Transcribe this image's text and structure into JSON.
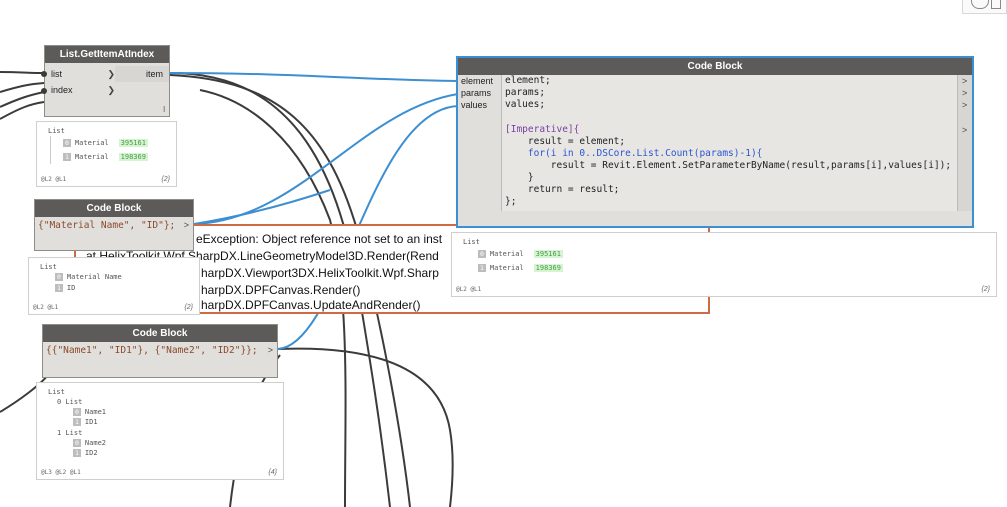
{
  "toolbar": {
    "icons": [
      "cloud-icon",
      "window-icon"
    ]
  },
  "getitem": {
    "title": "List.GetItemAtIndex",
    "inputs": [
      "list",
      "index"
    ],
    "output": "item",
    "lacing": "l",
    "preview": {
      "title": "List",
      "rows": [
        {
          "i": "0",
          "k": "Material",
          "v": "395161"
        },
        {
          "i": "1",
          "k": "Material",
          "v": "198369"
        }
      ],
      "footer": "@L2 @L1",
      "count": "{2}"
    }
  },
  "cb1": {
    "title": "Code Block",
    "code": "{\"Material Name\", \"ID\"};",
    "port": ">",
    "preview": {
      "title": "List",
      "rows": [
        {
          "i": "0",
          "v": "Material Name"
        },
        {
          "i": "1",
          "v": "ID"
        }
      ],
      "footer": "@L2 @L1",
      "count": "{2}"
    }
  },
  "cb2": {
    "title": "Code Block",
    "code": "{{\"Name1\", \"ID1\"}, {\"Name2\", \"ID2\"}};",
    "port": ">",
    "preview": {
      "title": "List",
      "groups": [
        {
          "label": "0 List",
          "rows": [
            {
              "i": "0",
              "v": "Name1"
            },
            {
              "i": "1",
              "v": "ID1"
            }
          ]
        },
        {
          "label": "1 List",
          "rows": [
            {
              "i": "0",
              "v": "Name2"
            },
            {
              "i": "1",
              "v": "ID2"
            }
          ]
        }
      ],
      "footer": "@L3 @L2 @L1",
      "count": "{4}"
    }
  },
  "cb3": {
    "title": "Code Block",
    "inputs": [
      "element",
      "params",
      "values"
    ],
    "code_lines": [
      "element;",
      "params;",
      "values;",
      "",
      "[Imperative]{",
      "    result = element;",
      "    for(i in 0..DSCore.List.Count(params)-1){",
      "        result = Revit.Element.SetParameterByName(result,params[i],values[i]);",
      "    }",
      "    return = result;",
      "};"
    ],
    "port": ">",
    "preview": {
      "title": "List",
      "rows": [
        {
          "i": "0",
          "k": "Material",
          "v": "395161"
        },
        {
          "i": "1",
          "k": "Material",
          "v": "198369"
        }
      ],
      "footer": "@L2 @L1",
      "count": "{2}"
    }
  },
  "error": {
    "lines": [
      "eException: Object reference not set to an inst",
      "at HelixToolkit.Wpf.SharpDX.LineGeometryModel3D.Render(Rend",
      "harpDX.Viewport3DX.HelixToolkit.Wpf.Sharp",
      "harpDX.DPFCanvas.Render()",
      "harpDX.DPFCanvas.UpdateAndRender()"
    ]
  },
  "colors": {
    "wire_blue": "#3d8fd1",
    "wire_dark": "#3b3b3b",
    "header": "#5d5b59",
    "error_border": "#cf6b42"
  }
}
